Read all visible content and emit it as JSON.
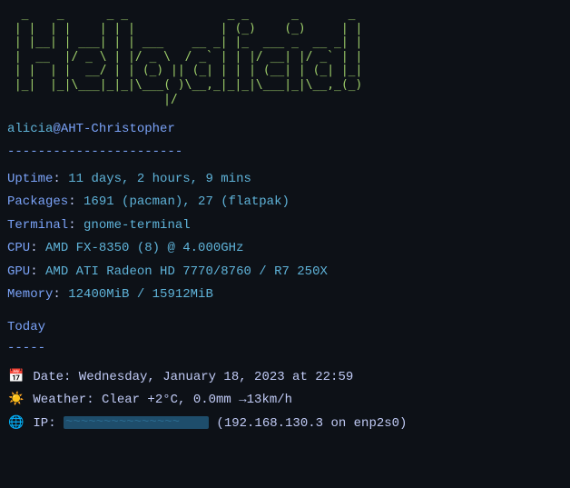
{
  "ascii_art": "  _    _      _ _              _ _      _       _ \n | |  | |    | | |            | (_)    (_)     | |\n | |__| | ___| | | ___    __ _| |_  ___ _  __ _| |\n |  __  |/ _ \\ | |/ _ \\  / _` | | |/ __| |/ _` | |\n | |  | |  __/ | | (_) || (_| | | | (__| | (_| |_|\n |_|  |_|\\___|_|_|\\___( )\\__,_|_|_|\\___|_|\\__,_(_)\n                      |/                          ",
  "user": "alicia",
  "at": "@",
  "host": "AHT-Christopher",
  "host_separator": "-----------------------",
  "info": {
    "uptime": {
      "label": "Uptime",
      "value": "11 days, 2 hours, 9 mins"
    },
    "packages": {
      "label": "Packages",
      "value": "1691 (pacman), 27 (flatpak)"
    },
    "terminal": {
      "label": "Terminal",
      "value": "gnome-terminal"
    },
    "cpu": {
      "label": "CPU",
      "value": "AMD FX-8350 (8) @ 4.000GHz"
    },
    "gpu": {
      "label": "GPU",
      "value": "AMD ATI Radeon HD 7770/8760 / R7 250X"
    },
    "memory": {
      "label": "Memory",
      "value": "12400MiB / 15912MiB"
    }
  },
  "today": {
    "header": "Today",
    "separator": "-----",
    "date": {
      "icon": "📅",
      "text": " Date: Wednesday, January 18, 2023 at 22:59"
    },
    "weather": {
      "icon": "☀️",
      "text": " Weather: Clear +2°C, 0.0mm →13km/h"
    },
    "ip": {
      "icon": "🌐",
      "prefix": " IP: ",
      "suffix": " (192.168.130.3 on enp2s0)"
    }
  }
}
